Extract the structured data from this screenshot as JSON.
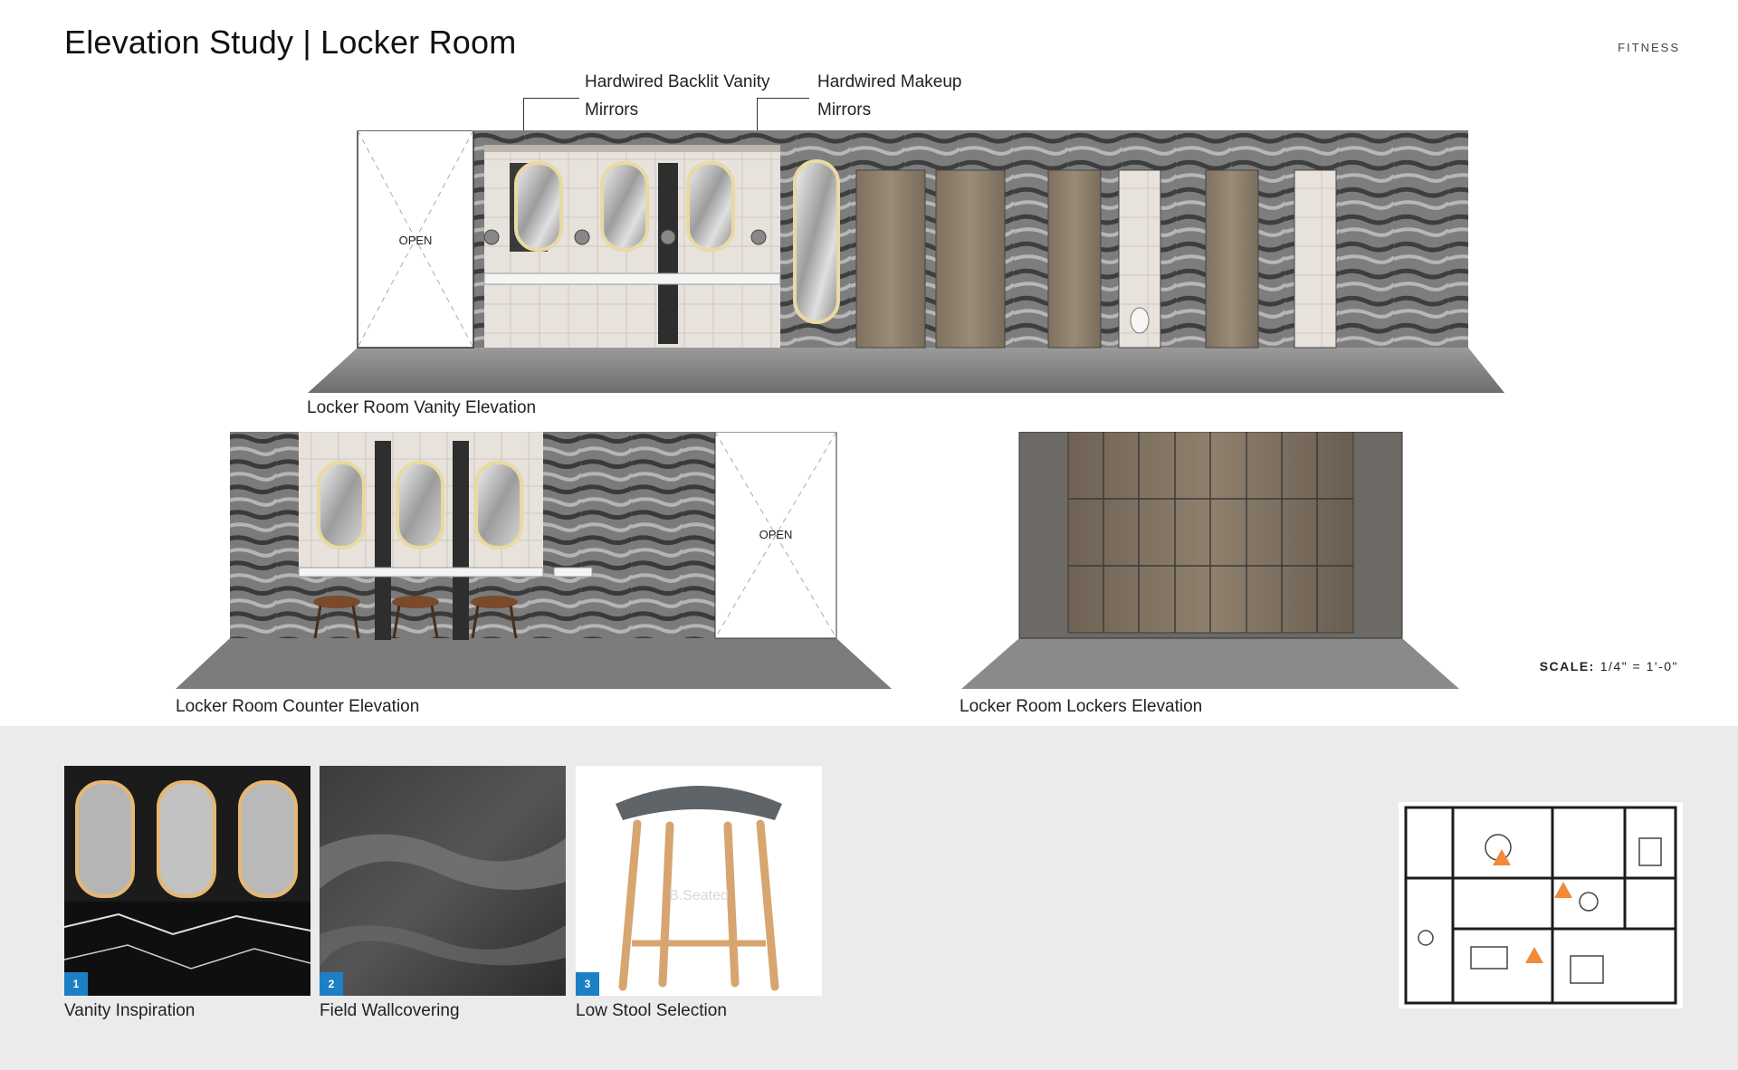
{
  "header": {
    "title": "Elevation Study | Locker Room",
    "section_tag": "FITNESS"
  },
  "callouts": {
    "vanity_mirrors": [
      "Hardwired Backlit Vanity",
      "Mirrors"
    ],
    "makeup_mirrors": [
      "Hardwired Makeup",
      "Mirrors"
    ]
  },
  "elevations": {
    "vanity": {
      "caption": "Locker Room Vanity Elevation",
      "open_label": "OPEN"
    },
    "counter": {
      "caption": "Locker Room Counter Elevation",
      "open_label": "OPEN"
    },
    "lockers": {
      "caption": "Locker Room Lockers Elevation"
    }
  },
  "scale": {
    "label": "SCALE:",
    "value": "1/4\" = 1'-0\""
  },
  "materials": [
    {
      "number": "1",
      "caption": "Vanity Inspiration"
    },
    {
      "number": "2",
      "caption": "Field Wallcovering"
    },
    {
      "number": "3",
      "caption": "Low Stool Selection"
    }
  ],
  "stool_watermark": "B.Seated",
  "colors": {
    "accent_blue": "#1d7fc4",
    "keyplan_marker": "#f28a3a",
    "band_gray": "#ebebeb",
    "wood": "#8a7a68",
    "stone": "#5b5b5b"
  }
}
